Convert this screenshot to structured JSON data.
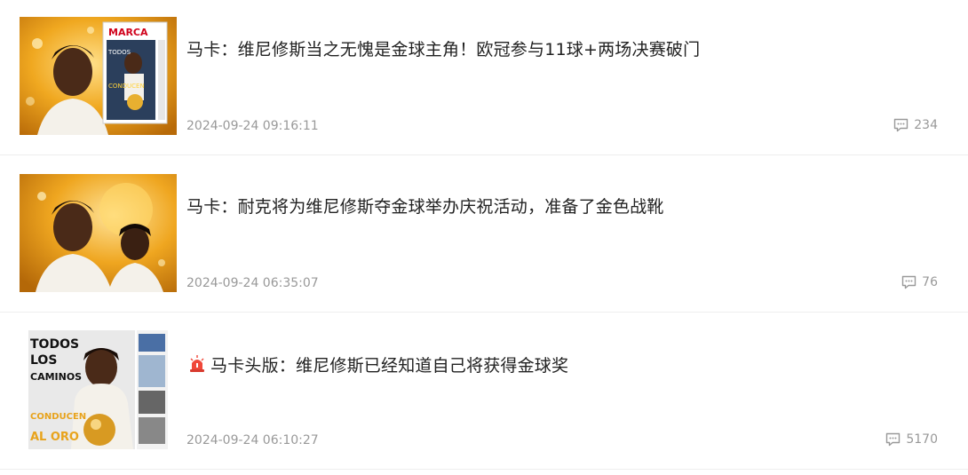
{
  "articles": [
    {
      "title": "马卡：维尼修斯当之无愧是金球主角！欧冠参与11球+两场决赛破门",
      "date": "2024-09-24 09:16:11",
      "comments": "234",
      "thumbnail": {
        "masthead": "MARCA",
        "cover_text": "TODOS LOS CAMINOS CONDUCEN AL ORO"
      }
    },
    {
      "title": "马卡：耐克将为维尼修斯夺金球举办庆祝活动，准备了金色战靴",
      "date": "2024-09-24 06:35:07",
      "comments": "76"
    },
    {
      "title": "马卡头版：维尼修斯已经知道自己将获得金球奖",
      "date": "2024-09-24 06:10:27",
      "comments": "5170",
      "hot_icon": "siren-icon",
      "thumbnail": {
        "cover_text": "TODOS LOS CAMINOS CONDUCEN AL ORO"
      }
    }
  ],
  "colors": {
    "title": "#222222",
    "meta": "#999999",
    "divider": "#eeeeee",
    "gold": "#e8a31c"
  }
}
